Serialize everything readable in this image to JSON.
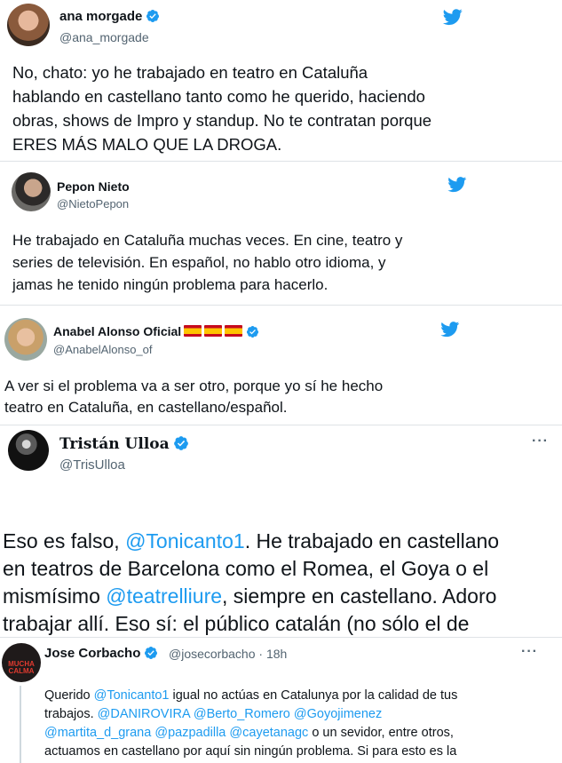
{
  "tweets": [
    {
      "name": "ana morgade",
      "handle": "@ana_morgade",
      "body": "No, chato: yo he trabajado en teatro en Cataluña\nhablando en castellano tanto como he querido, haciendo\nobras, shows de Impro y standup. No te contratan porque\nERES MÁS MALO QUE LA DROGA."
    },
    {
      "name": "Pepon Nieto",
      "handle": "@NietoPepon",
      "body": "He trabajado en Cataluña muchas veces. En cine, teatro y\nseries de televisión. En español, no hablo otro idioma, y\njamas he tenido ningún problema para hacerlo."
    },
    {
      "name": "Anabel Alonso Oficial",
      "handle": "@AnabelAlonso_of",
      "body": "A ver si el problema va a ser otro, porque yo sí he hecho\nteatro en Cataluña, en castellano/español."
    },
    {
      "name": "Tristán Ulloa",
      "handle": "@TrisUlloa",
      "body_parts": [
        "Eso es falso, ",
        "@Tonicanto1",
        ". He trabajado en castellano\nen teatros de Barcelona como el Romea, el Goya o el\nmismísimo ",
        "@teatrelliure",
        ", siempre en castellano. Adoro\ntrabajar allí. Eso sí: el público catalán (no sólo el de\nBarna) no es nada fácil, hay que ganárselo."
      ]
    },
    {
      "name": "Jose Corbacho",
      "handle": "@josecorbacho",
      "time": "· 18h",
      "avatar_text": "MUCHA CALMA",
      "body_parts": [
        "Querido ",
        "@Tonicanto1",
        " igual no actúas en Catalunya por la calidad de tus\ntrabajos.  ",
        "@DANIROVIRA",
        " ",
        "@Berto_Romero",
        " ",
        "@Goyojimenez",
        "\n",
        "@martita_d_grana",
        " ",
        "@pazpadilla",
        "  ",
        "@cayetanagc",
        " o un sevidor, entre otros,\nactuamos en castellano por aquí sin ningún problema.  Si para esto es la\n“Oficina”, tela..."
      ]
    }
  ],
  "icons": {
    "twitter": "twitter-bird-icon",
    "verified": "verified-badge-icon",
    "more": "more-options-icon",
    "flag": "spain-flag-icon"
  },
  "colors": {
    "link": "#1d9bf0",
    "twitter_blue": "#1d9bf0",
    "secondary": "#536471",
    "text": "#0f1419"
  },
  "more_glyph": "···"
}
